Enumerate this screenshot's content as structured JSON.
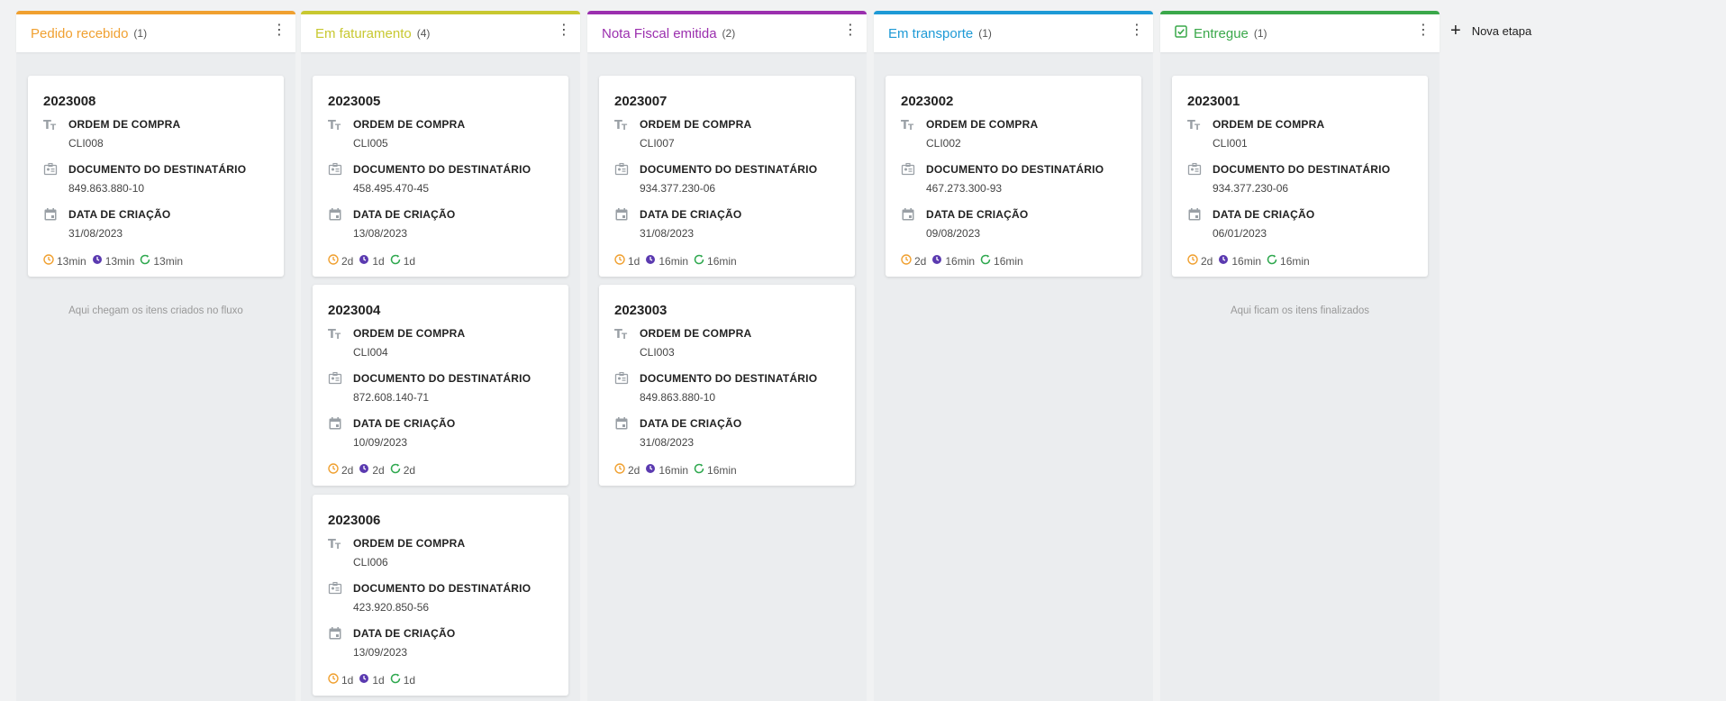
{
  "columns": [
    {
      "title": "Pedido recebido",
      "count": "(1)",
      "color": "#f0a030",
      "empty_text": "Aqui chegam os itens criados no fluxo",
      "cards": [
        {
          "id": "2023008",
          "ordem": "CLI008",
          "documento": "849.863.880-10",
          "data": "31/08/2023",
          "t1": "13min",
          "t2": "13min",
          "t3": "13min"
        }
      ]
    },
    {
      "title": "Em faturamento",
      "count": "(4)",
      "color": "#c8c830",
      "empty_text": "",
      "cards": [
        {
          "id": "2023005",
          "ordem": "CLI005",
          "documento": "458.495.470-45",
          "data": "13/08/2023",
          "t1": "2d",
          "t2": "1d",
          "t3": "1d"
        },
        {
          "id": "2023004",
          "ordem": "CLI004",
          "documento": "872.608.140-71",
          "data": "10/09/2023",
          "t1": "2d",
          "t2": "2d",
          "t3": "2d"
        },
        {
          "id": "2023006",
          "ordem": "CLI006",
          "documento": "423.920.850-56",
          "data": "13/09/2023",
          "t1": "1d",
          "t2": "1d",
          "t3": "1d"
        }
      ]
    },
    {
      "title": "Nota Fiscal emitida",
      "count": "(2)",
      "color": "#9b2fae",
      "empty_text": "",
      "cards": [
        {
          "id": "2023007",
          "ordem": "CLI007",
          "documento": "934.377.230-06",
          "data": "31/08/2023",
          "t1": "1d",
          "t2": "16min",
          "t3": "16min"
        },
        {
          "id": "2023003",
          "ordem": "CLI003",
          "documento": "849.863.880-10",
          "data": "31/08/2023",
          "t1": "2d",
          "t2": "16min",
          "t3": "16min"
        }
      ]
    },
    {
      "title": "Em transporte",
      "count": "(1)",
      "color": "#1e9ad6",
      "empty_text": "",
      "cards": [
        {
          "id": "2023002",
          "ordem": "CLI002",
          "documento": "467.273.300-93",
          "data": "09/08/2023",
          "t1": "2d",
          "t2": "16min",
          "t3": "16min"
        }
      ]
    },
    {
      "title": "Entregue",
      "count": "(1)",
      "color": "#3aa84a",
      "empty_text": "Aqui ficam os itens finalizados",
      "cards": [
        {
          "id": "2023001",
          "ordem": "CLI001",
          "documento": "934.377.230-06",
          "data": "06/01/2023",
          "t1": "2d",
          "t2": "16min",
          "t3": "16min"
        }
      ]
    }
  ],
  "labels": {
    "ordem": "ORDEM DE COMPRA",
    "documento": "DOCUMENTO DO DESTINATÁRIO",
    "data": "DATA DE CRIAÇÃO"
  },
  "new_stage_label": "Nova etapa",
  "icons": {
    "text_field": "text-type-icon",
    "document": "id-card-icon",
    "date": "calendar-icon",
    "menu": "kebab-menu-icon",
    "timer1": "clock-icon",
    "timer2": "hand-timer-icon",
    "timer3": "refresh-timer-icon",
    "done": "check-square-icon"
  },
  "timer_colors": {
    "t1": "#f0a030",
    "t2": "#5b3ab0",
    "t3": "#2fa84f"
  }
}
